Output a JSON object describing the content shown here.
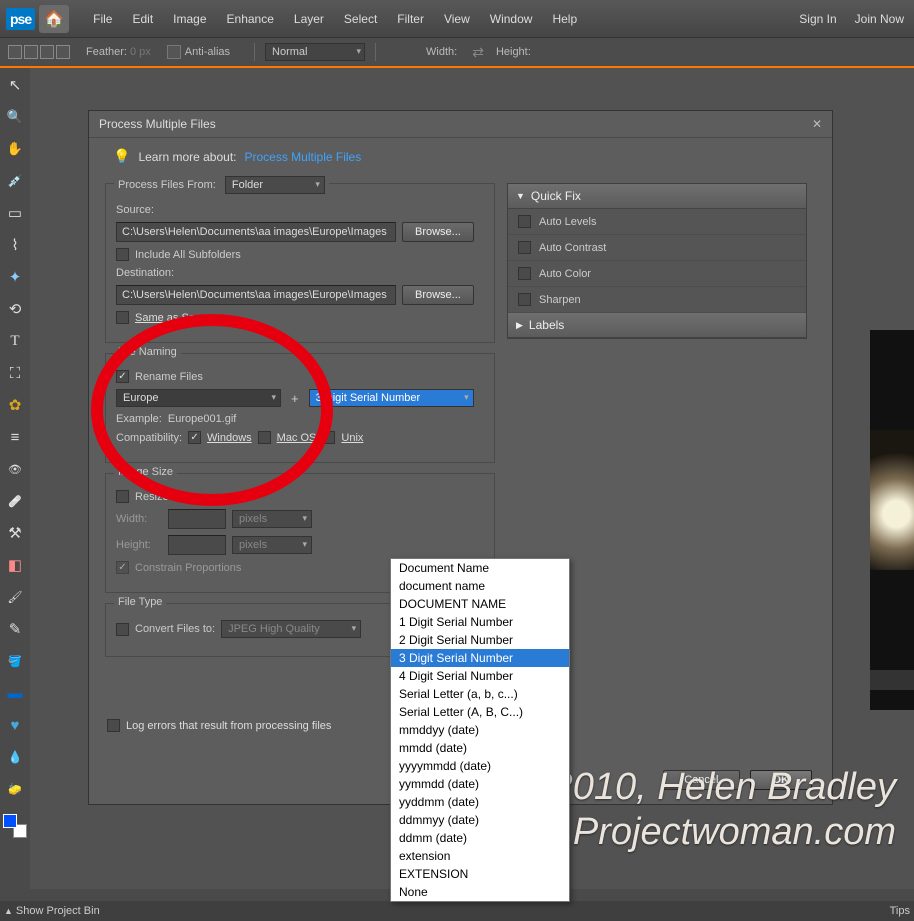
{
  "topbar": {
    "logo": "pse",
    "menu": [
      "File",
      "Edit",
      "Image",
      "Enhance",
      "Layer",
      "Select",
      "Filter",
      "View",
      "Window",
      "Help"
    ],
    "sign_in": "Sign In",
    "join_now": "Join Now"
  },
  "optionsbar": {
    "feather_label": "Feather:",
    "feather_value": "0 px",
    "antialias": "Anti-alias",
    "mode": "Normal",
    "width_label": "Width:",
    "height_label": "Height:"
  },
  "dialog": {
    "title": "Process Multiple Files",
    "learn_label": "Learn more about:",
    "learn_link": "Process Multiple Files",
    "process_files_from": {
      "legend": "Process Files From:",
      "folder": "Folder",
      "source_label": "Source:",
      "source_path": "C:\\Users\\Helen\\Documents\\aa images\\Europe\\Images fo",
      "include_subfolders": "Include All Subfolders",
      "destination_label": "Destination:",
      "destination_path": "C:\\Users\\Helen\\Documents\\aa images\\Europe\\Images fo",
      "same_as_source": "Same as Source",
      "browse": "Browse..."
    },
    "file_naming": {
      "legend": "File Naming",
      "rename_files": "Rename Files",
      "base_name": "Europe",
      "suffix_selected": "3 Digit Serial Number",
      "example_label": "Example:",
      "example_value": "Europe001.gif",
      "compatibility_label": "Compatibility:",
      "windows": "Windows",
      "mac": "Mac OS",
      "unix": "Unix",
      "dropdown_options": [
        "Document Name",
        "document name",
        "DOCUMENT NAME",
        "1 Digit Serial Number",
        "2 Digit Serial Number",
        "3 Digit Serial Number",
        "4 Digit Serial Number",
        "Serial Letter (a, b, c...)",
        "Serial Letter (A, B, C...)",
        "mmddyy (date)",
        "mmdd (date)",
        "yyyymmdd (date)",
        "yymmdd (date)",
        "yyddmm (date)",
        "ddmmyy (date)",
        "ddmm (date)",
        "extension",
        "EXTENSION",
        "None"
      ]
    },
    "image_size": {
      "legend": "Image Size",
      "resize_images": "Resize Images",
      "width_label": "Width:",
      "height_label": "Height:",
      "unit": "pixels",
      "constrain": "Constrain Proportions"
    },
    "file_type": {
      "legend": "File Type",
      "convert_label": "Convert Files to:",
      "format": "JPEG High Quality"
    },
    "quick_fix": {
      "header": "Quick Fix",
      "items": [
        "Auto Levels",
        "Auto Contrast",
        "Auto Color",
        "Sharpen"
      ]
    },
    "labels_header": "Labels",
    "log_errors": "Log errors that result from processing files",
    "cancel": "Cancel",
    "ok": "OK"
  },
  "watermark": {
    "line1": "© 2010, Helen Bradley",
    "line2": "Projectwoman.com"
  },
  "statusbar": {
    "show_bin": "Show Project Bin",
    "tips": "Tips"
  }
}
